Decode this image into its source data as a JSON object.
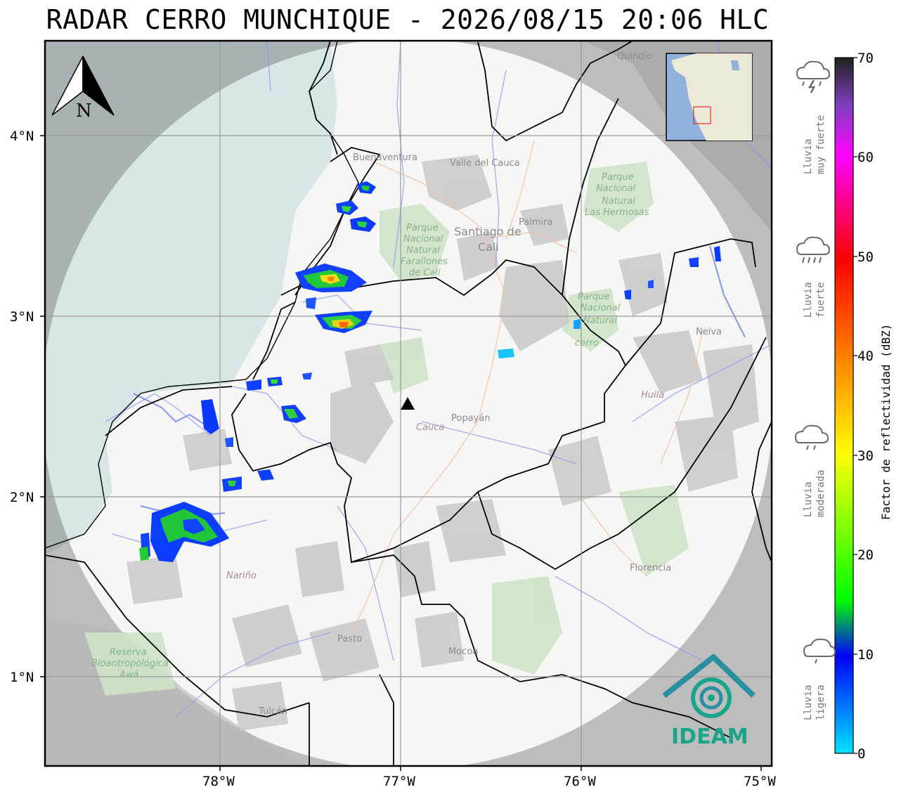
{
  "title": "RADAR CERRO MUNCHIQUE - 2026/08/15 20:06 HLC",
  "axes": {
    "lat_ticks": [
      "4°N",
      "3°N",
      "2°N",
      "1°N"
    ],
    "lon_ticks": [
      "78°W",
      "77°W",
      "76°W",
      "75°W"
    ]
  },
  "north_arrow": {
    "label": "N",
    "icon": "north-arrow-icon"
  },
  "places": {
    "buenaventura": "Buenaventura",
    "valle": "Valle del Cauca",
    "quindio": "Quindío",
    "palmira": "Palmira",
    "cali_1": "Santiago de",
    "cali_2": "Cali",
    "farallones": [
      "Parque",
      "Nacional",
      "Natural",
      "Farallones",
      "de Cali"
    ],
    "hermosas": [
      "Parque",
      "Nacional",
      "Natural",
      "Las Hermosas"
    ],
    "huila_park": [
      "Parque",
      "Nacional",
      "Natural",
      "cerro"
    ],
    "neiva": "Neiva",
    "huila": "Huila",
    "cauca": "Cauca",
    "popayan": "Popayán",
    "narino": "Nariño",
    "florencia": "Florencia",
    "pasto": "Pasto",
    "mocoa": "Mocoa",
    "tulcan": "Tulcán",
    "awa": [
      "Reserva",
      "Bioantropológica",
      "Awá"
    ]
  },
  "radar_site_icon": "triangle-marker-icon",
  "logo": {
    "text": "IDEAM",
    "icon": "ideam-logo-icon"
  },
  "colorbar": {
    "title": "Factor de reflectividad (dBZ)",
    "ticks": [
      "70",
      "60",
      "50",
      "40",
      "30",
      "20",
      "10",
      "0"
    ],
    "colors": [
      "#00e5ff",
      "#0000ff",
      "#00ff00",
      "#ffff00",
      "#ff8000",
      "#ff0000",
      "#ff00ff",
      "#8040c0",
      "#202020"
    ]
  },
  "categories": [
    {
      "label_1": "Lluvia",
      "label_2": "muy fuerte",
      "icon": "thunderstorm-icon"
    },
    {
      "label_1": "Lluvia",
      "label_2": "fuerte",
      "icon": "heavy-rain-icon"
    },
    {
      "label_1": "Lluvia",
      "label_2": "moderada",
      "icon": "moderate-rain-icon"
    },
    {
      "label_1": "Lluvia",
      "label_2": "ligera",
      "icon": "light-rain-icon"
    }
  ]
}
